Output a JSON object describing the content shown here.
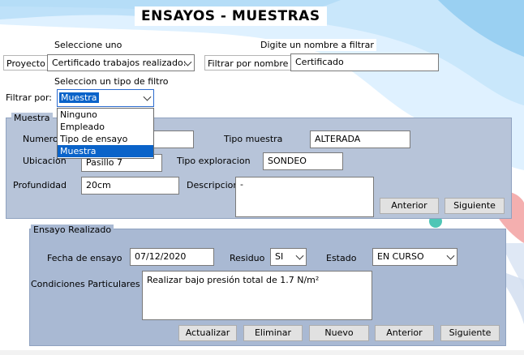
{
  "title": "ENSAYOS - MUESTRAS",
  "filter_bar": {
    "select_one_label": "Seleccione uno",
    "name_filter_label": "Digite un nombre a filtrar",
    "project_button": "Proyecto",
    "project_value": "Certificado trabajos realizado:",
    "filter_by_name_button": "Filtrar por nombre",
    "name_filter_value": "Certificado",
    "filter_type_label": "Seleccion un tipo de filtro",
    "filter_by_label": "Filtrar por:",
    "filter_by_value": "Muestra",
    "filter_options": [
      "Ninguno",
      "Empleado",
      "Tipo de ensayo",
      "Muestra"
    ],
    "filter_selected_index": 3
  },
  "muestra": {
    "legend": "Muestra",
    "numero_label": "Numero",
    "numero_value": "",
    "tipo_muestra_label": "Tipo muestra",
    "tipo_muestra_value": "ALTERADA",
    "ubicacion_label": "Ubicacion",
    "ubicacion_value": "Pasillo 7",
    "tipo_exploracion_label": "Tipo exploracion",
    "tipo_exploracion_value": "SONDEO",
    "profundidad_label": "Profundidad",
    "profundidad_value": "20cm",
    "descripcion_label": "Descripcion",
    "descripcion_value": "-",
    "prev_button": "Anterior",
    "next_button": "Siguiente"
  },
  "ensayo": {
    "legend": "Ensayo Realizado",
    "fecha_label": "Fecha de ensayo",
    "fecha_value": "07/12/2020",
    "residuo_label": "Residuo",
    "residuo_value": "SI",
    "estado_label": "Estado",
    "estado_value": "EN CURSO",
    "condiciones_label": "Condiciones Particulares",
    "condiciones_value": "Realizar bajo presión total de 1.7 N/m²",
    "update_button": "Actualizar",
    "delete_button": "Eliminar",
    "new_button": "Nuevo",
    "prev_button": "Anterior",
    "next_button": "Siguiente"
  },
  "colors": {
    "panel": "#b7c4d9",
    "panel_inner": "#a9b9d3",
    "highlight": "#0a63c9",
    "decor_blue": "#8ecbf0",
    "decor_red": "#e86a6a",
    "decor_teal": "#4fc6b6"
  }
}
